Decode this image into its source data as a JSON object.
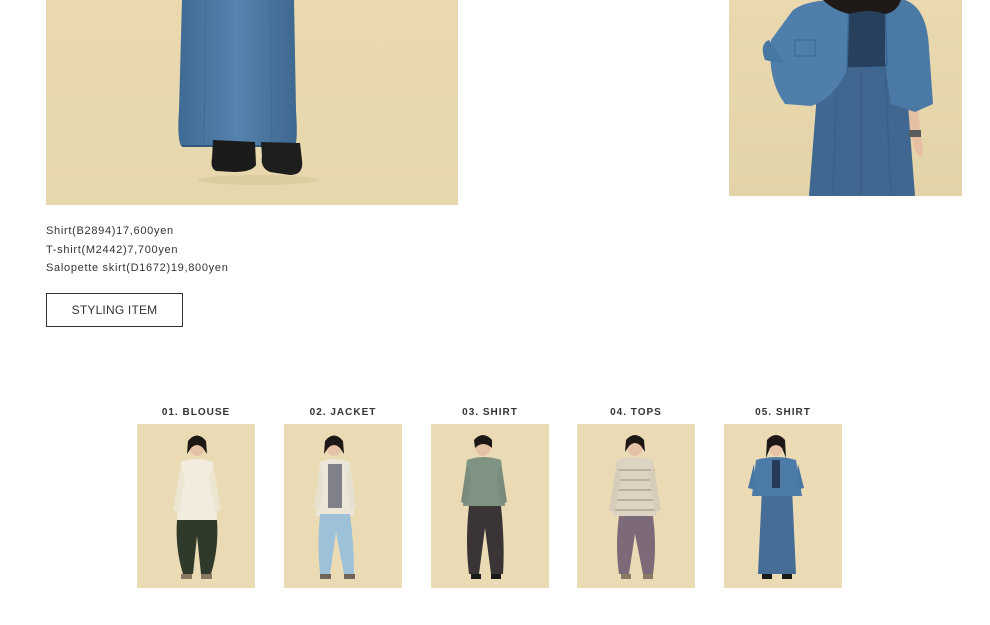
{
  "styling": {
    "items": [
      "Shirt(B2894)17,600yen",
      "T-shirt(M2442)7,700yen",
      "Salopette skirt(D1672)19,800yen"
    ],
    "button_label": "STYLING ITEM"
  },
  "thumbnails": [
    {
      "label": "01. BLOUSE"
    },
    {
      "label": "02. JACKET"
    },
    {
      "label": "03. SHIRT"
    },
    {
      "label": "04. TOPS"
    },
    {
      "label": "05. SHIRT"
    }
  ],
  "colors": {
    "backdrop": "#e8dab2",
    "denim": "#4d77a0",
    "text": "#333333"
  }
}
